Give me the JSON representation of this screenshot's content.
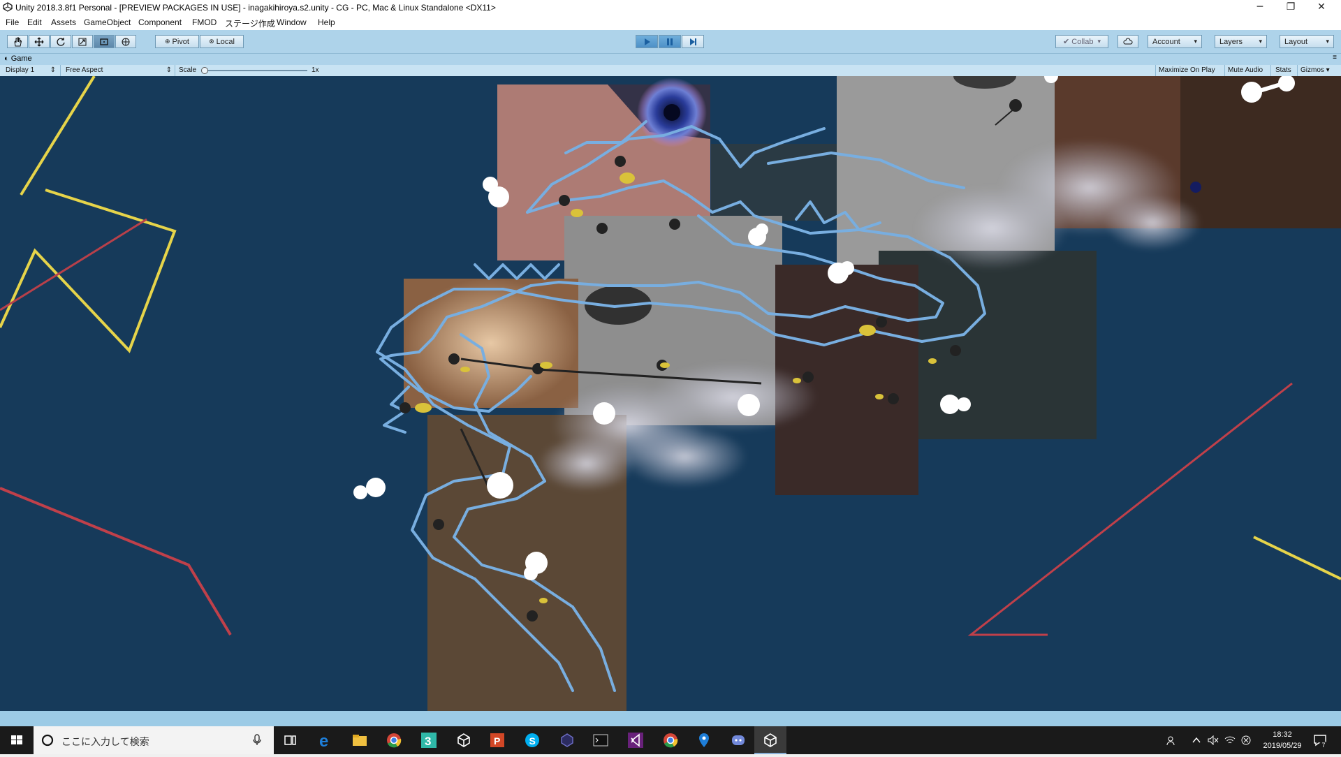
{
  "window": {
    "title": "Unity 2018.3.8f1 Personal - [PREVIEW PACKAGES IN USE] - inagakihiroya.s2.unity - CG - PC, Mac & Linux Standalone <DX11>",
    "controls": [
      "minimize-icon",
      "restore-icon",
      "close-icon"
    ]
  },
  "menu": {
    "items": [
      "File",
      "Edit",
      "Assets",
      "GameObject",
      "Component",
      "FMOD",
      "ステージ作成",
      "Window",
      "Help"
    ]
  },
  "toolbar": {
    "tools": [
      "hand-icon",
      "move-icon",
      "rotate-icon",
      "scale-icon",
      "rect-icon",
      "transform-icon"
    ],
    "pivot_label": "Pivot",
    "local_label": "Local",
    "collab_label": "Collab",
    "account_label": "Account",
    "layers_label": "Layers",
    "layout_label": "Layout"
  },
  "game_view": {
    "tab_label": "Game",
    "display_label": "Display 1",
    "aspect_label": "Free Aspect",
    "scale_label": "Scale",
    "scale_value": "1x",
    "maximize_label": "Maximize On Play",
    "mute_label": "Mute Audio",
    "stats_label": "Stats",
    "gizmos_label": "Gizmos"
  },
  "taskbar": {
    "search_placeholder": "ここに入力して検索",
    "apps": [
      "task-view-icon",
      "edge-icon",
      "file-explorer-icon",
      "chrome-icon",
      "app-3-icon",
      "unity-icon",
      "powerpoint-icon",
      "skype-icon",
      "app-icon",
      "terminal-icon",
      "visual-studio-icon",
      "chrome-icon",
      "maps-icon",
      "discord-icon",
      "unity-icon"
    ],
    "time": "18:32",
    "date": "2019/05/29",
    "notification_count": "7"
  },
  "colors": {
    "toolbar_bg": "#aed3ea",
    "viewport_bg": "#163a5a",
    "dragon_stroke": "#78aee0",
    "star_yellow": "#e8d84a",
    "line_red": "#c0404a"
  }
}
